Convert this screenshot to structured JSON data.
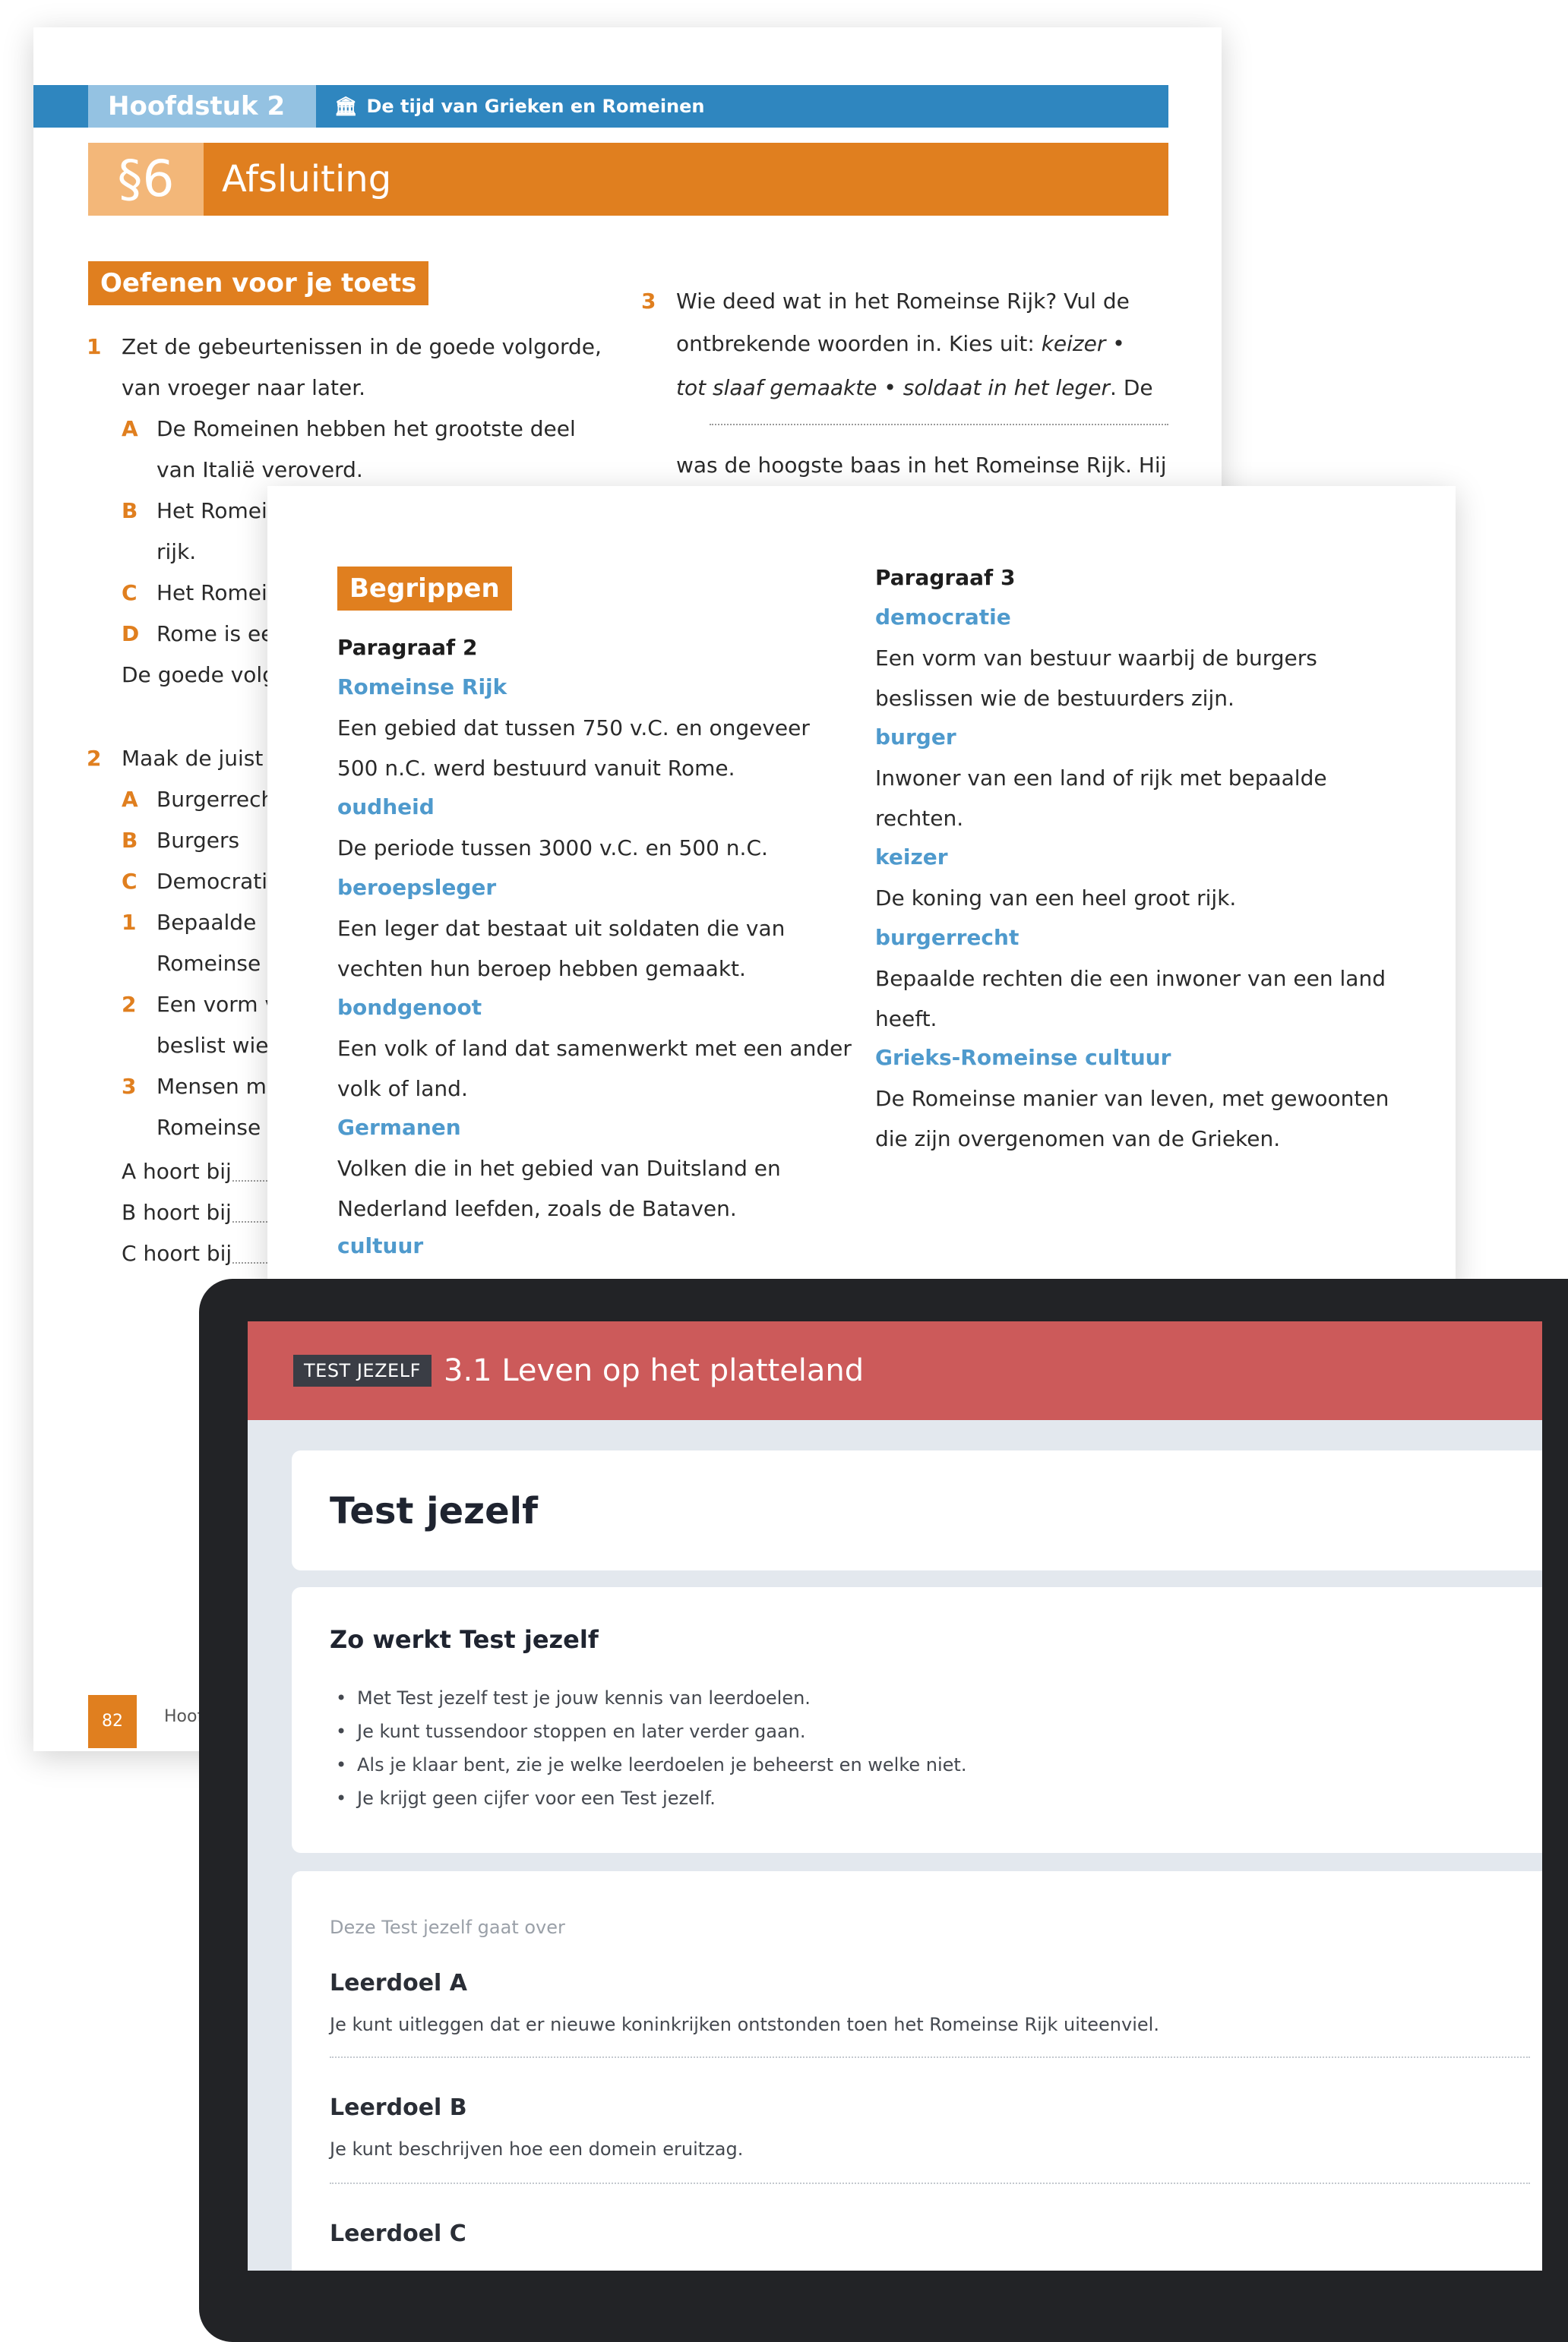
{
  "page1": {
    "chapter": "Hoofdstuk 2",
    "chapter_title": "De tijd van Grieken en Romeinen",
    "section_num": "§6",
    "section_title": "Afsluiting",
    "exercise_tag": "Oefenen voor je toets",
    "q1": {
      "num": "1",
      "line1": "Zet de gebeurtenissen in de goede volgorde,",
      "line2": "van vroeger naar later.",
      "a_letter": "A",
      "a1": "De Romeinen hebben het grootste deel",
      "a2": "van Italië veroverd.",
      "b_letter": "B",
      "b1": "Het Romei",
      "b2": "rijk.",
      "c_letter": "C",
      "c1": "Het Romei",
      "d_letter": "D",
      "d1": "Rome is ee",
      "answer": "De goede volg"
    },
    "q2": {
      "num": "2",
      "line1": "Maak de juist",
      "a_letter": "A",
      "a": "Burgerrech",
      "b_letter": "B",
      "b": "Burgers",
      "c_letter": "C",
      "c": "Democrati",
      "n1": "1",
      "n1a": "Bepaalde",
      "n1b": "Romeinse",
      "n2": "2",
      "n2a": "Een vorm v",
      "n2b": "beslist wie",
      "n3": "3",
      "n3a": "Mensen m",
      "n3b": "Romeinse",
      "ans_a": "A hoort bij",
      "ans_b": "B hoort bij",
      "ans_c": "C hoort bij"
    },
    "q3": {
      "num": "3",
      "line1": "Wie deed wat in het Romeinse Rijk? Vul de",
      "line2a": "ontbrekende woorden in. Kies uit: ",
      "line2b": "keizer",
      "line2c": " •",
      "line3a": "tot slaaf gemaakte",
      "line3b": " • ",
      "line3c": "soldaat in het leger",
      "line3d": ". De",
      "line4": "was de hoogste baas in het Romeinse Rijk. Hij"
    },
    "page_number": "82",
    "footer": "Hoof"
  },
  "page2": {
    "tag": "Begrippen",
    "left": {
      "heading": "Paragraaf 2",
      "t1": "Romeinse Rijk",
      "d1a": "Een gebied dat tussen 750 v.C. en ongeveer",
      "d1b": "500 n.C. werd bestuurd vanuit Rome.",
      "t2": "oudheid",
      "d2": "De periode tussen 3000 v.C. en 500 n.C.",
      "t3": "beroepsleger",
      "d3a": "Een leger dat bestaat uit soldaten die van",
      "d3b": "vechten hun beroep hebben gemaakt.",
      "t4": "bondgenoot",
      "d4a": "Een volk of land dat samenwerkt met een ander",
      "d4b": "volk of land.",
      "t5": "Germanen",
      "d5a": "Volken die in het gebied van Duitsland en",
      "d5b": "Nederland leefden, zoals de Bataven.",
      "t6": "cultuur"
    },
    "right": {
      "heading": "Paragraaf 3",
      "t1": "democratie",
      "d1a": "Een vorm van bestuur waarbij de burgers",
      "d1b": "beslissen wie de bestuurders zijn.",
      "t2": "burger",
      "d2a": "Inwoner van een land of rijk met bepaalde",
      "d2b": "rechten.",
      "t3": "keizer",
      "d3": "De koning van een heel groot rijk.",
      "t4": "burgerrecht",
      "d4a": "Bepaalde rechten die een inwoner van een land",
      "d4b": "heeft.",
      "t5": "Grieks-Romeinse cultuur",
      "d5a": "De Romeinse manier van leven, met gewoonten",
      "d5b": "die zijn overgenomen van de Grieken."
    }
  },
  "tablet": {
    "badge": "TEST JEZELF",
    "title": "3.1  Leven op het platteland",
    "card1_title": "Test jezelf",
    "card2_title": "Zo werkt Test jezelf",
    "bullets": [
      "Met Test jezelf test je jouw kennis van leerdoelen.",
      "Je kunt tussendoor stoppen en later verder gaan.",
      "Als je klaar bent, zie je welke leerdoelen je beheerst en welke niet.",
      "Je krijgt geen cijfer voor een Test jezelf."
    ],
    "card3_intro": "Deze Test jezelf gaat over",
    "goal_a_title": "Leerdoel A",
    "goal_a_text": "Je kunt uitleggen dat er nieuwe koninkrijken ontstonden toen het Romeinse Rijk uiteenviel.",
    "goal_b_title": "Leerdoel B",
    "goal_b_text": "Je kunt beschrijven hoe een domein eruitzag.",
    "goal_c_title": "Leerdoel C"
  }
}
